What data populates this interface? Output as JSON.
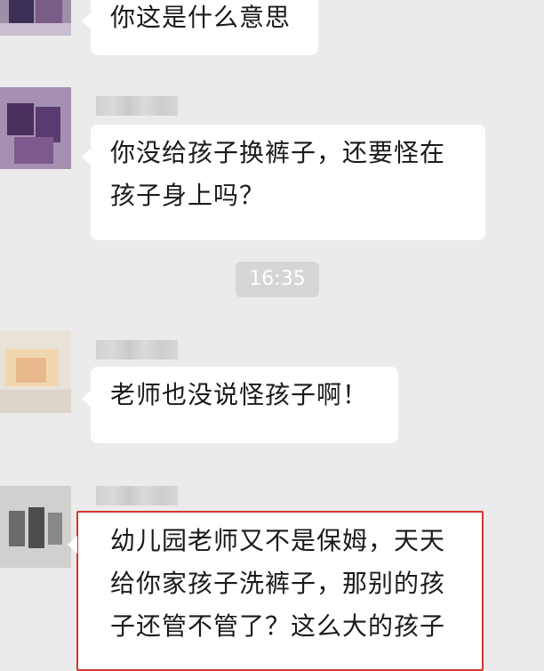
{
  "messages": [
    {
      "lines": [
        "你这是什么意思"
      ]
    },
    {
      "lines": [
        "你没给孩子换裤子，还要怪在",
        "孩子身上吗？"
      ]
    },
    {
      "lines": [
        "老师也没说怪孩子啊！"
      ]
    },
    {
      "lines": [
        "幼儿园老师又不是保姆，天天",
        "给你家孩子洗裤子，那别的孩",
        "子还管不管了？这么大的孩子"
      ]
    }
  ],
  "timestamp": "16:35",
  "colors": {
    "background": "#ebebeb",
    "bubble": "#ffffff",
    "highlight_border": "#d9342b",
    "time_pill": "#d6d6d6"
  }
}
